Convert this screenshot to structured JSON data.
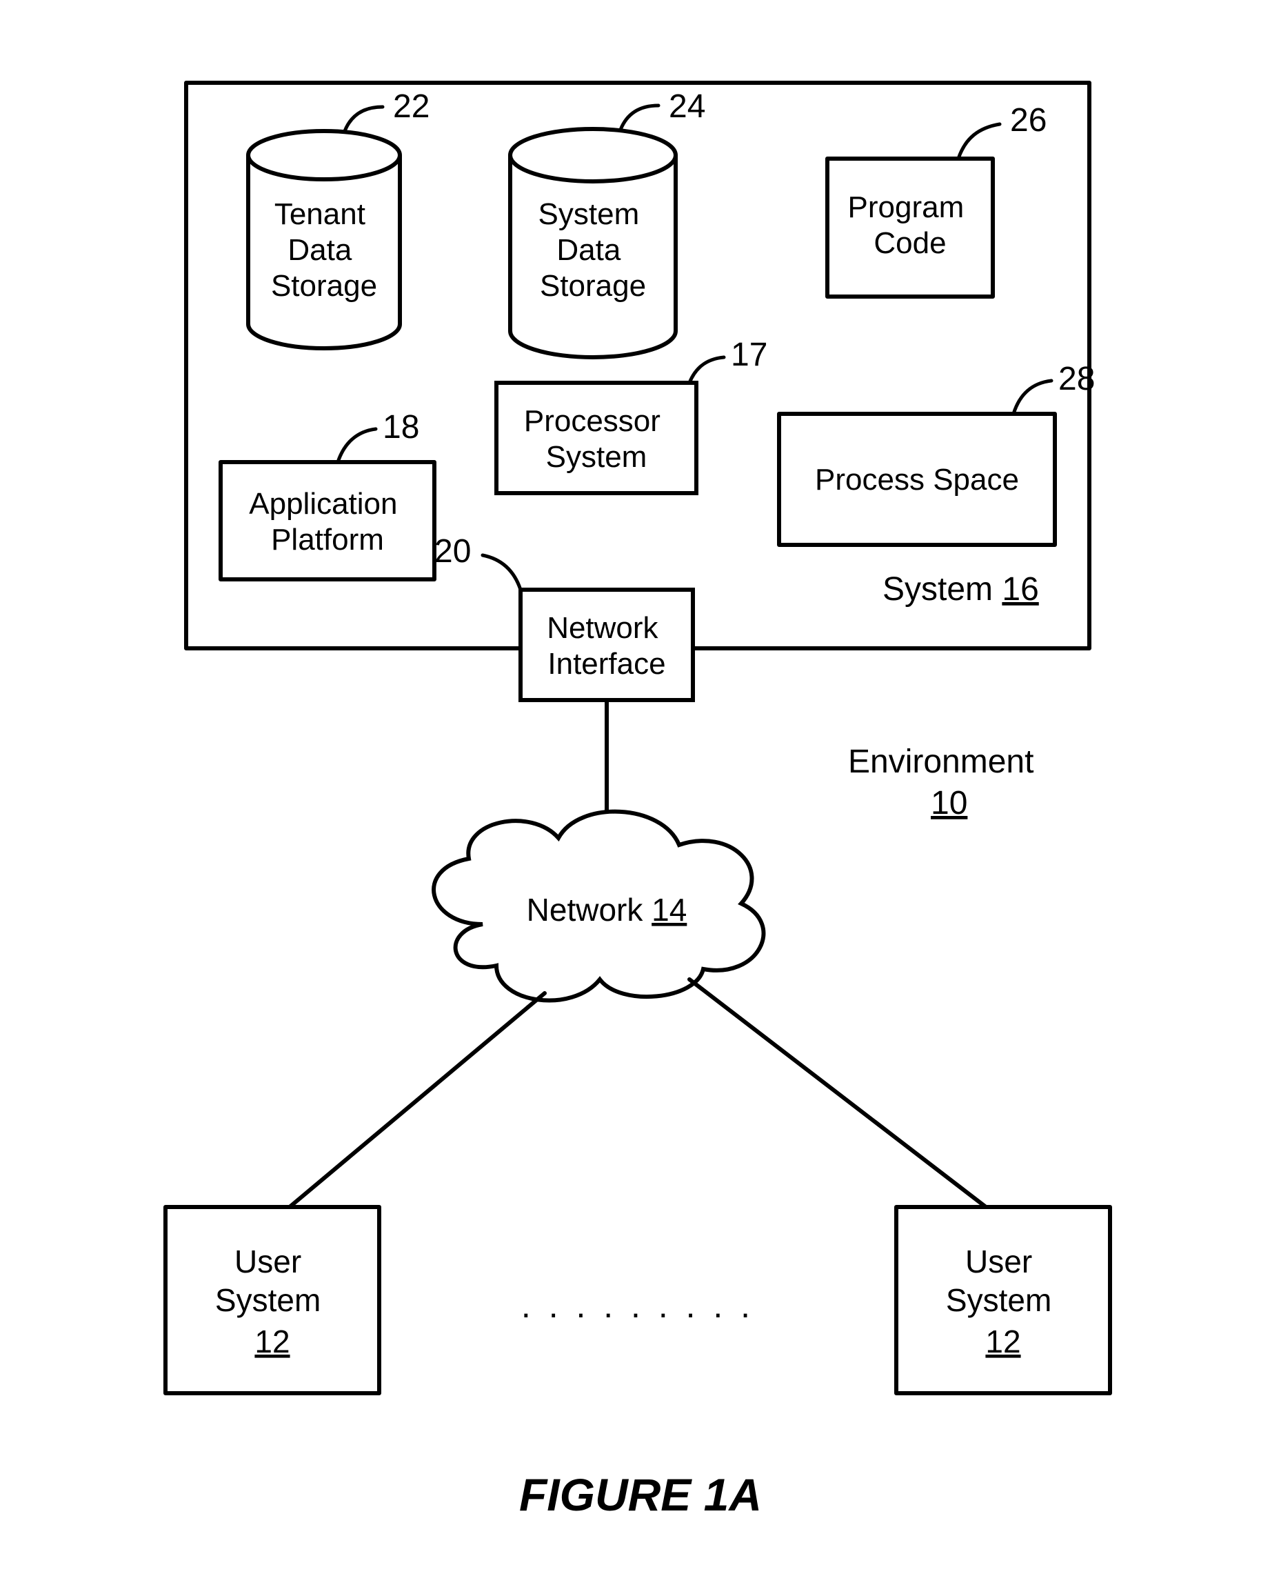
{
  "figure_title": "FIGURE 1A",
  "environment": {
    "label": "Environment",
    "ref": "10"
  },
  "system_box": {
    "label": "System",
    "ref": "16"
  },
  "components": {
    "tenant_data_storage": {
      "line1": "Tenant",
      "line2": "Data",
      "line3": "Storage",
      "ref": "22"
    },
    "system_data_storage": {
      "line1": "System",
      "line2": "Data",
      "line3": "Storage",
      "ref": "24"
    },
    "program_code": {
      "line1": "Program",
      "line2": "Code",
      "ref": "26"
    },
    "processor_system": {
      "line1": "Processor",
      "line2": "System",
      "ref": "17"
    },
    "application_platform": {
      "line1": "Application",
      "line2": "Platform",
      "ref": "18"
    },
    "process_space": {
      "line1": "Process Space",
      "ref": "28"
    },
    "network_interface": {
      "line1": "Network",
      "line2": "Interface",
      "ref": "20"
    },
    "network": {
      "label": "Network",
      "ref": "14"
    }
  },
  "user_system": {
    "line1": "User",
    "line2": "System",
    "ref": "12"
  },
  "ellipsis": ". . . . . . . . ."
}
